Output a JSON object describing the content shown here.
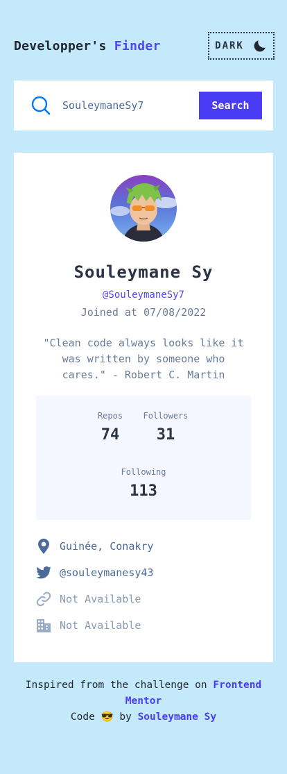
{
  "header": {
    "logo_part1": "Developper's",
    "logo_part2": "Finder",
    "theme_label": "DARK"
  },
  "search": {
    "value": "SouleymaneSy7",
    "button_label": "Search"
  },
  "profile": {
    "name": "Souleymane Sy",
    "login": "@SouleymaneSy7",
    "joined": "Joined at 07/08/2022",
    "bio": "\"Clean code always looks like it was written by someone who cares.\" - Robert C. Martin"
  },
  "stats": {
    "repos_label": "Repos",
    "repos": "74",
    "followers_label": "Followers",
    "followers": "31",
    "following_label": "Following",
    "following": "113"
  },
  "links": {
    "location": "Guinée, Conakry",
    "twitter": "@souleymanesy43",
    "website": "Not Available",
    "company": "Not Available"
  },
  "footer": {
    "line1_prefix": "Inspired from the challenge on",
    "line1_link": "Frontend Mentor",
    "line2_prefix": "Code",
    "line2_emoji": "😎",
    "line2_by": "by",
    "line2_link": "Souleymane Sy"
  },
  "colors": {
    "background": "#c4e9fa",
    "accent": "#4a3cf5",
    "text": "#2b3442"
  }
}
